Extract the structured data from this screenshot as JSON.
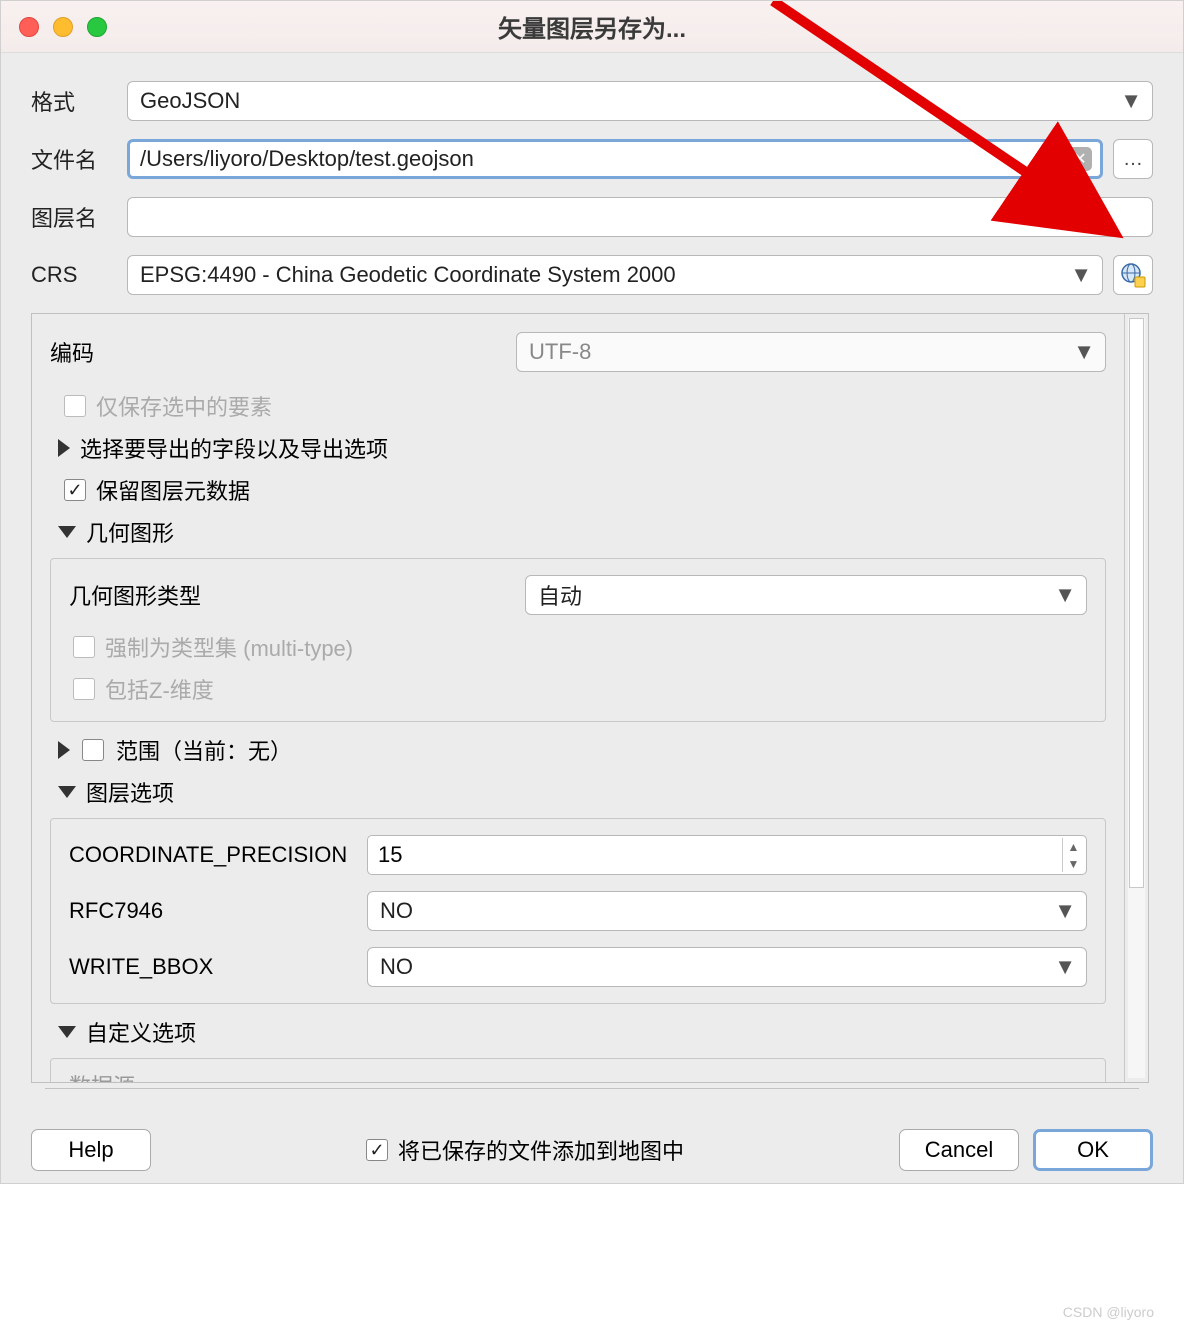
{
  "title": "矢量图层另存为...",
  "labels": {
    "format": "格式",
    "filename": "文件名",
    "layername": "图层名",
    "crs": "CRS",
    "encoding": "编码",
    "only_selected": "仅保存选中的要素",
    "select_fields": "选择要导出的字段以及导出选项",
    "keep_metadata": "保留图层元数据",
    "geometry": "几何图形",
    "geometry_type": "几何图形类型",
    "force_multi": "强制为类型集 (multi-type)",
    "include_z": "包括Z-维度",
    "extent": "范围（当前：无）",
    "layer_options": "图层选项",
    "coord_precision": "COORDINATE_PRECISION",
    "rfc7946": "RFC7946",
    "write_bbox": "WRITE_BBOX",
    "custom_options": "自定义选项",
    "datasource": "数据源",
    "add_to_map": "将已保存的文件添加到地图中"
  },
  "values": {
    "format": "GeoJSON",
    "filename": "/Users/liyoro/Desktop/test.geojson",
    "layername": "",
    "crs": "EPSG:4490 - China Geodetic Coordinate System 2000",
    "encoding": "UTF-8",
    "geometry_type": "自动",
    "coord_precision": "15",
    "rfc7946": "NO",
    "write_bbox": "NO"
  },
  "buttons": {
    "help": "Help",
    "cancel": "Cancel",
    "ok": "OK",
    "browse": "…"
  },
  "watermark": "CSDN @liyoro"
}
